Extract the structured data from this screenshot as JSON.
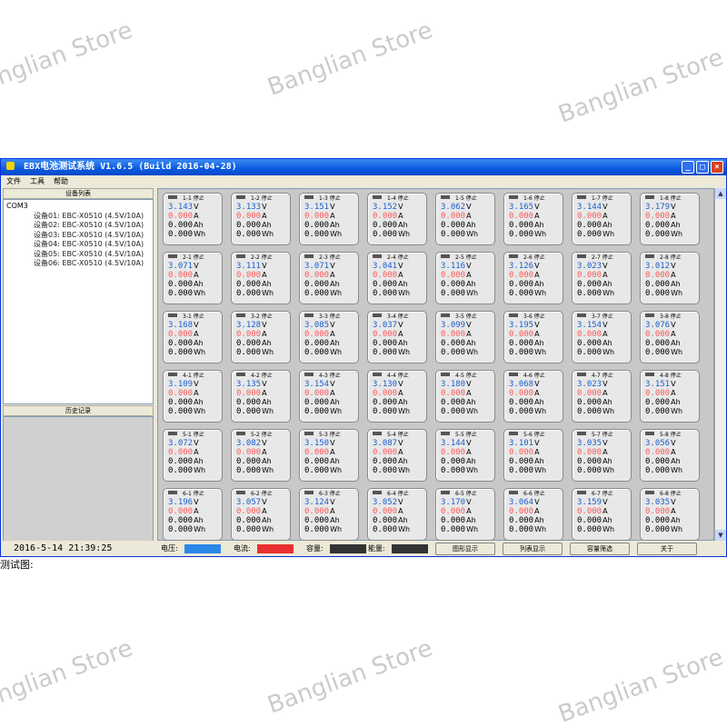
{
  "window": {
    "title": "EBX电池测试系统 V1.6.5 (Build 2016-04-28)",
    "menu": [
      "文件",
      "工具",
      "帮助"
    ]
  },
  "tree": {
    "header": "设备列表",
    "port": "COM3",
    "devices": [
      "设备01: EBC-X0510 (4.5V/10A)",
      "设备02: EBC-X0510 (4.5V/10A)",
      "设备03: EBC-X0510 (4.5V/10A)",
      "设备04: EBC-X0510 (4.5V/10A)",
      "设备05: EBC-X0510 (4.5V/10A)",
      "设备06: EBC-X0510 (4.5V/10A)"
    ]
  },
  "history": {
    "header": "历史记录"
  },
  "grid": {
    "status_word": "停止",
    "current": "0.000",
    "ah": "0.000",
    "wh": "0.000",
    "unit_v": "V",
    "unit_a": "A",
    "unit_ah": "Ah",
    "unit_wh": "Wh",
    "rows": [
      [
        "3.143",
        "3.133",
        "3.151",
        "3.152",
        "3.062",
        "3.165",
        "3.144",
        "3.179"
      ],
      [
        "3.071",
        "3.111",
        "3.071",
        "3.041",
        "3.116",
        "3.126",
        "3.023",
        "3.012"
      ],
      [
        "3.168",
        "3.128",
        "3.085",
        "3.037",
        "3.099",
        "3.195",
        "3.154",
        "3.076"
      ],
      [
        "3.109",
        "3.135",
        "3.154",
        "3.130",
        "3.180",
        "3.068",
        "3.023",
        "3.151"
      ],
      [
        "3.072",
        "3.082",
        "3.150",
        "3.087",
        "3.144",
        "3.101",
        "3.035",
        "3.056"
      ],
      [
        "3.196",
        "3.057",
        "3.124",
        "3.052",
        "3.170",
        "3.064",
        "3.159",
        "3.035"
      ]
    ]
  },
  "status": {
    "datetime": "2016-5-14  21:39:25",
    "legend_voltage": "电压:",
    "legend_current": "电流:",
    "legend_capacity": "容量:",
    "legend_energy": "能量:",
    "btn_graph": "图形显示",
    "btn_list": "列表显示",
    "btn_capacity": "容量筛选",
    "btn_more": "关于",
    "voltage_color": "#2a88e8",
    "current_color": "#e83030",
    "capacity_color": "#333333",
    "energy_color": "#333333"
  },
  "caption": "测试图:",
  "watermark": "Banglian Store"
}
